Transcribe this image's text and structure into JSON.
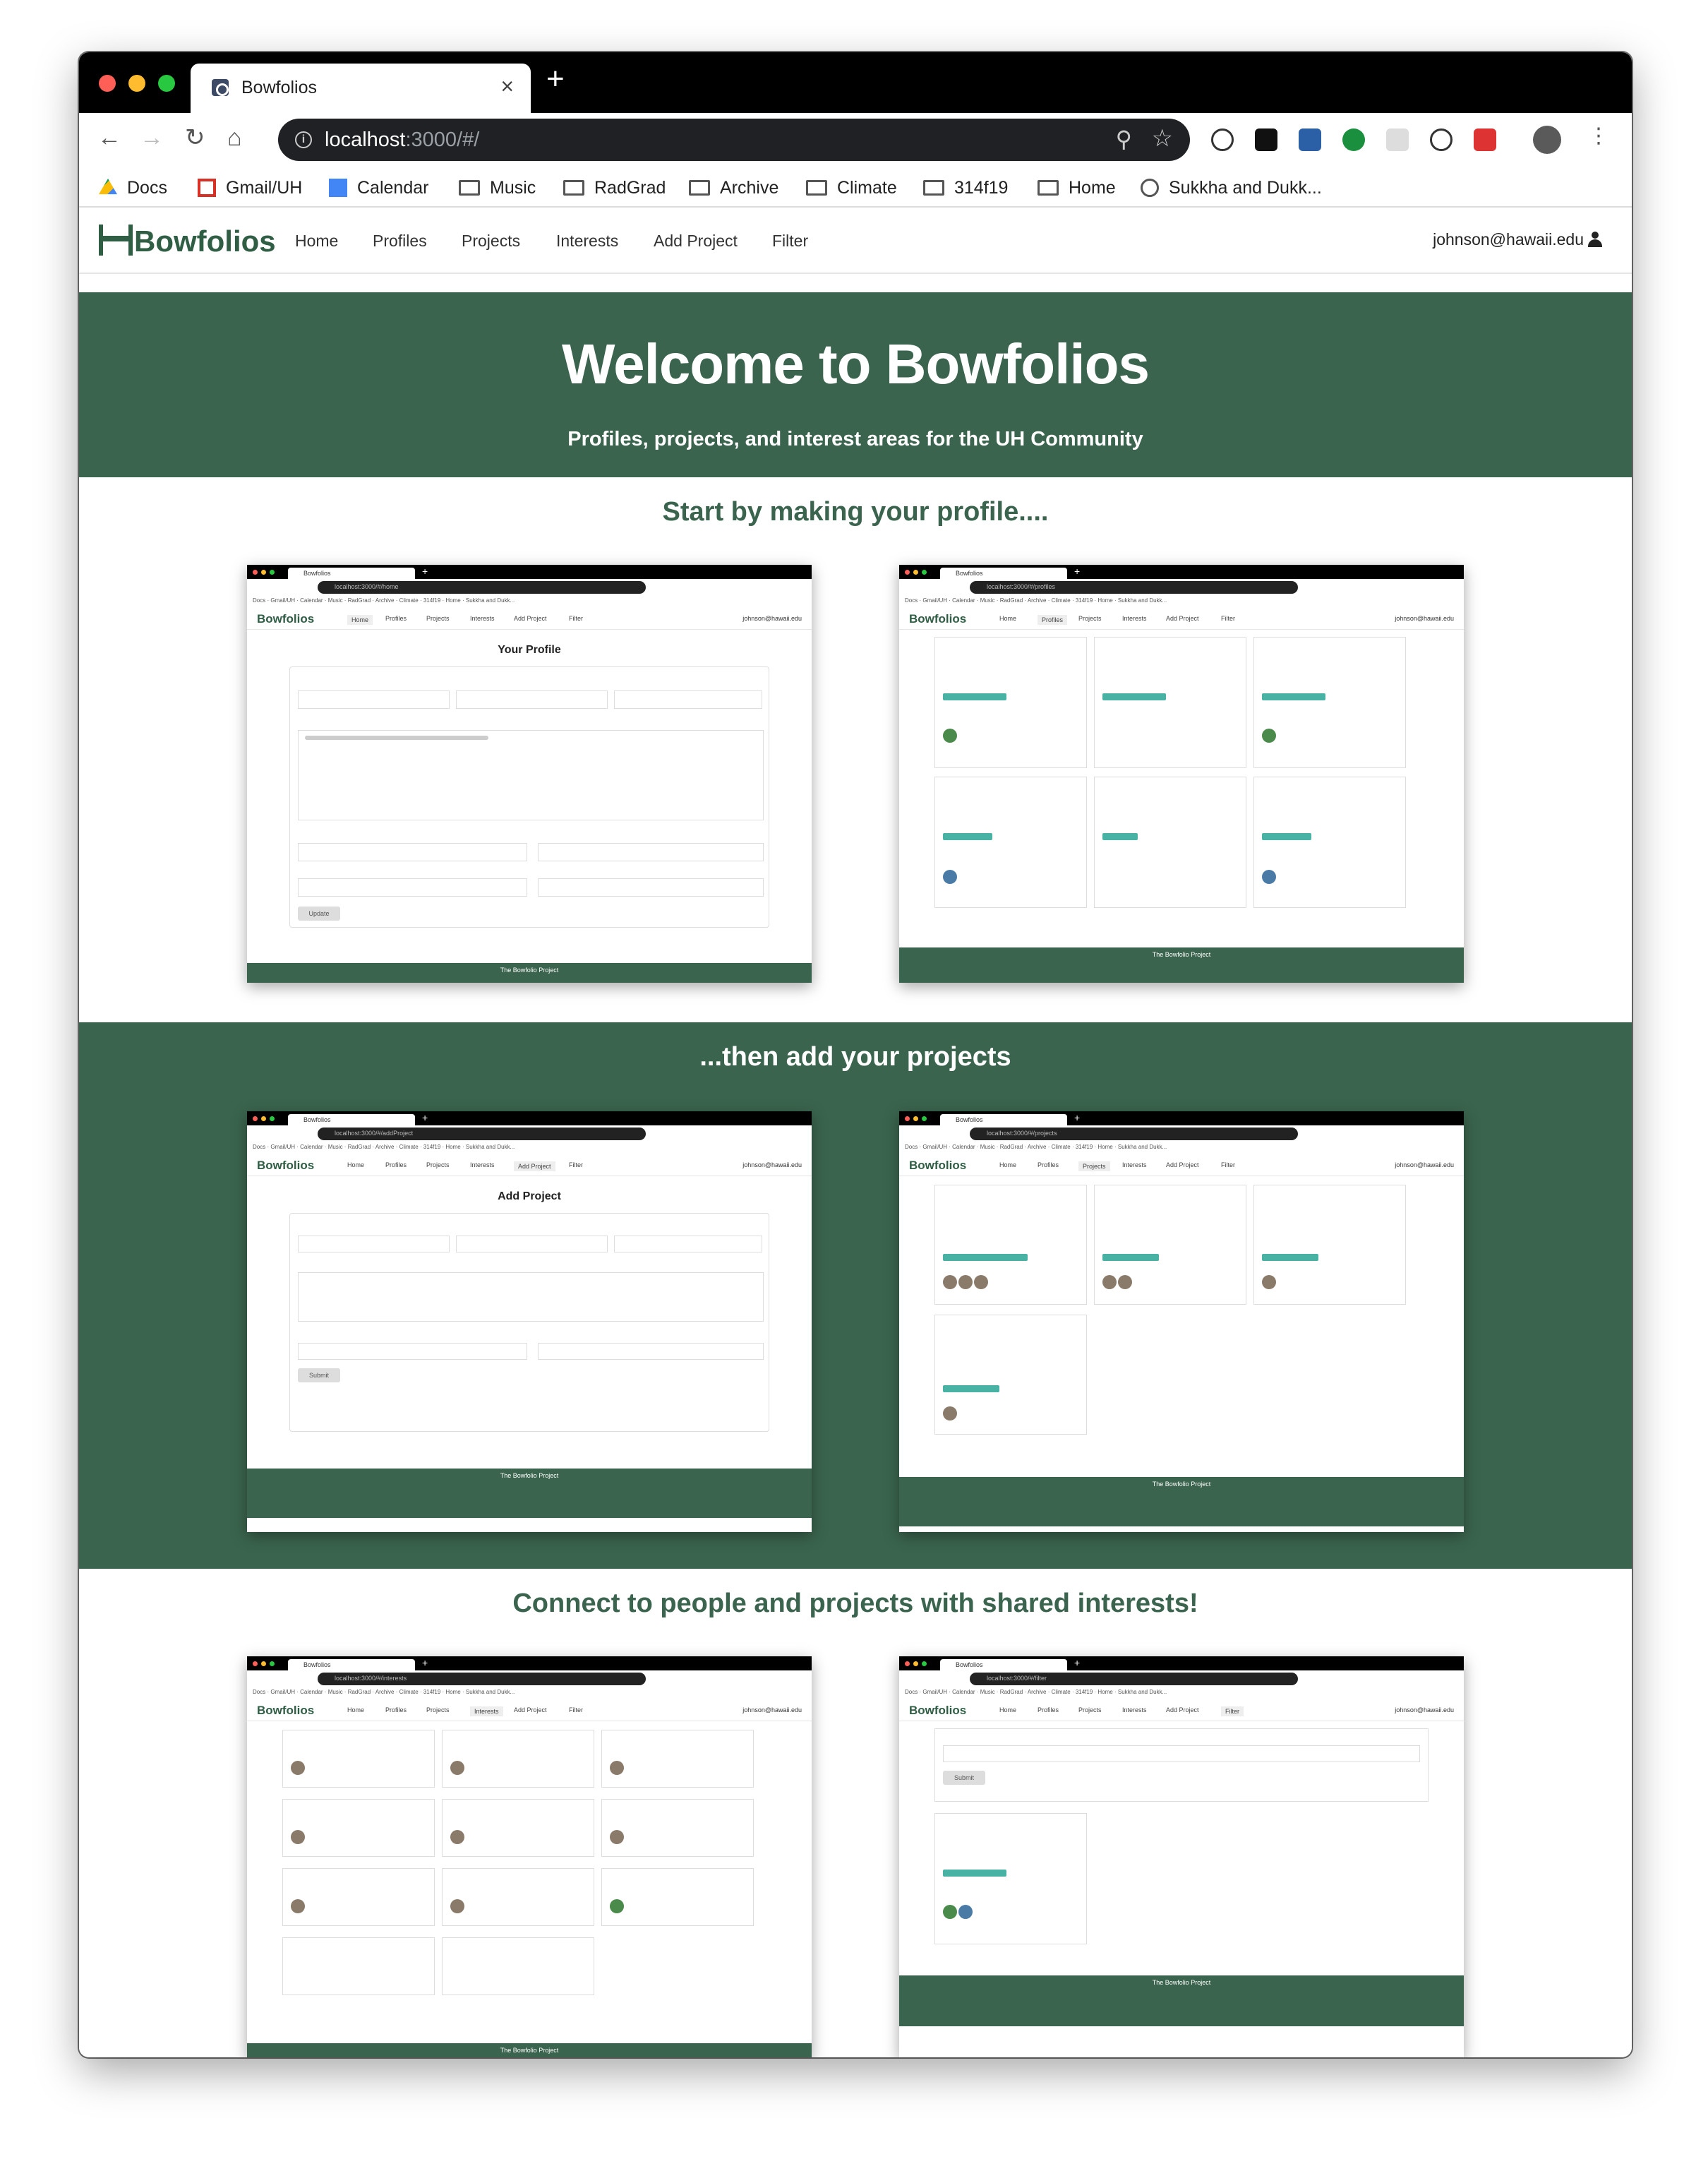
{
  "browser": {
    "tab_title": "Bowfolios",
    "url_host": "localhost",
    "url_path": ":3000/#/",
    "bookmarks": [
      "Docs",
      "Gmail/UH",
      "Calendar",
      "Music",
      "RadGrad",
      "Archive",
      "Climate",
      "314f19",
      "Home",
      "Sukkha and Dukk..."
    ]
  },
  "site": {
    "logo": "Bowfolios",
    "menu": [
      "Home",
      "Profiles",
      "Projects",
      "Interests",
      "Add Project",
      "Filter"
    ],
    "user": "johnson@hawaii.edu"
  },
  "hero": {
    "title": "Welcome to Bowfolios",
    "subtitle": "Profiles, projects, and interest areas for the UH Community"
  },
  "sections": {
    "profile": "Start by making your profile....",
    "projects": "...then add your projects",
    "connect": "Connect to people and projects with shared interests!"
  },
  "shots": {
    "profile_url": "localhost:3000/#/home",
    "profiles_url": "localhost:3000/#/profiles",
    "addproject_url": "localhost:3000/#/addProject",
    "projects_url": "localhost:3000/#/projects",
    "interests_url": "localhost:3000/#/interests",
    "filter_url": "localhost:3000/#/filter",
    "your_profile": "Your Profile",
    "add_project": "Add Project",
    "footer": "The Bowfolio Project"
  },
  "colors": {
    "brand_green": "#3a644d",
    "tag_teal": "#48b3a4"
  }
}
